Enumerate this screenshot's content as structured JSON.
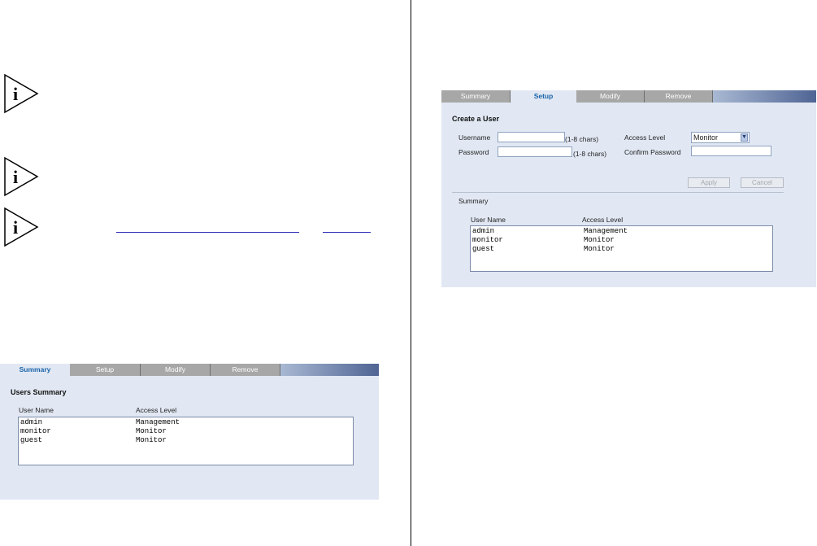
{
  "panel_left": {
    "tabs": [
      "Summary",
      "Setup",
      "Modify",
      "Remove"
    ],
    "active_tab": "Summary",
    "heading": "Users Summary",
    "columns": [
      "User Name",
      "Access Level"
    ],
    "rows": [
      {
        "name": "admin",
        "level": "Management"
      },
      {
        "name": "monitor",
        "level": "Monitor"
      },
      {
        "name": "guest",
        "level": "Monitor"
      }
    ]
  },
  "panel_right": {
    "tabs": [
      "Summary",
      "Setup",
      "Modify",
      "Remove"
    ],
    "active_tab": "Setup",
    "heading": "Create a User",
    "username_label": "Username",
    "username_value": "",
    "username_hint": "(1-8 chars)",
    "password_label": "Password",
    "password_value": "",
    "password_hint": "(1-8 chars)",
    "access_level_label": "Access Level",
    "access_level_value": "Monitor",
    "confirm_password_label": "Confirm Password",
    "confirm_password_value": "",
    "apply_label": "Apply",
    "cancel_label": "Cancel",
    "summary_label": "Summary",
    "columns": [
      "User Name",
      "Access Level"
    ],
    "rows": [
      {
        "name": "admin",
        "level": "Management"
      },
      {
        "name": "monitor",
        "level": "Monitor"
      },
      {
        "name": "guest",
        "level": "Monitor"
      }
    ]
  },
  "icons": {
    "note": "info-note-icon"
  },
  "colors": {
    "panel_bg": "#e1e8f3",
    "tab_inactive": "#a7a7a7",
    "tab_active_text": "#1b63a8",
    "tab_bar_gradient_end": "#4f6494"
  }
}
